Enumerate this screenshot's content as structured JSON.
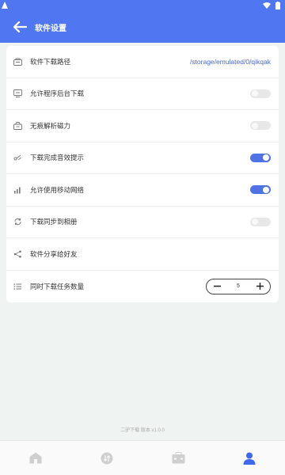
{
  "theme": {
    "primary": "#5077f1",
    "toggle_on": "#4f73e4",
    "path_color": "#4a67c9"
  },
  "appbar": {
    "title": "软件设置",
    "back_icon": "arrow-left-icon"
  },
  "settings": {
    "download_path": {
      "label": "软件下载路径",
      "value": "/storage/emulated/0/qikqak"
    },
    "background_download": {
      "label": "允许程序后台下载",
      "enabled": false
    },
    "magnet_parse": {
      "label": "无痕解析磁力",
      "enabled": false
    },
    "complete_sound": {
      "label": "下载完成音效提示",
      "enabled": true
    },
    "mobile_network": {
      "label": "允许使用移动网络",
      "enabled": true
    },
    "sync_album": {
      "label": "下载同步到相册",
      "enabled": false
    },
    "share": {
      "label": "软件分享给好友"
    },
    "concurrent": {
      "label": "同时下载任务数量",
      "value": "5",
      "minus": "−",
      "plus": "+"
    }
  },
  "version": "二驴下载 版本 v1.0.0",
  "navbar": {
    "items": [
      {
        "icon": "home-icon",
        "active": false
      },
      {
        "icon": "download-icon",
        "active": false
      },
      {
        "icon": "toolbox-icon",
        "active": false
      },
      {
        "icon": "user-icon",
        "active": true
      }
    ]
  }
}
